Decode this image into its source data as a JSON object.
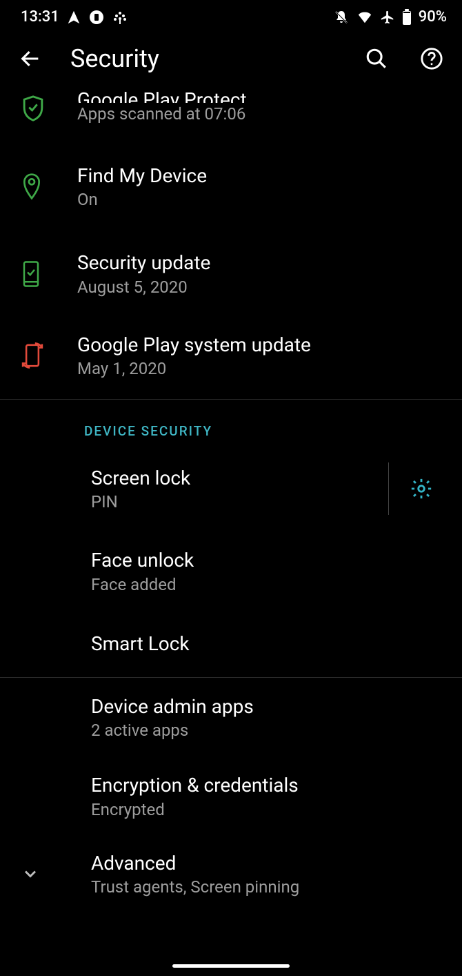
{
  "status": {
    "time": "13:31",
    "battery_text": "90%"
  },
  "header": {
    "title": "Security"
  },
  "items": {
    "play_protect": {
      "title": "Google Play Protect",
      "sub": "Apps scanned at 07:06"
    },
    "find_device": {
      "title": "Find My Device",
      "sub": "On"
    },
    "sec_update": {
      "title": "Security update",
      "sub": "August 5, 2020"
    },
    "gp_system": {
      "title": "Google Play system update",
      "sub": "May 1, 2020"
    }
  },
  "section": {
    "device_security": "DEVICE SECURITY"
  },
  "ds": {
    "screen_lock": {
      "title": "Screen lock",
      "sub": "PIN"
    },
    "face_unlock": {
      "title": "Face unlock",
      "sub": "Face added"
    },
    "smart_lock": {
      "title": "Smart Lock"
    },
    "admin_apps": {
      "title": "Device admin apps",
      "sub": "2 active apps"
    },
    "encryption": {
      "title": "Encryption & credentials",
      "sub": "Encrypted"
    },
    "advanced": {
      "title": "Advanced",
      "sub": "Trust agents, Screen pinning"
    }
  }
}
